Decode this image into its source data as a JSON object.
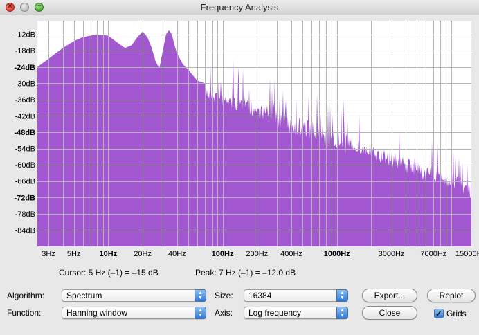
{
  "window": {
    "title": "Frequency Analysis"
  },
  "chart_data": {
    "type": "area",
    "xscale": "log",
    "xlim": [
      2.4,
      15000
    ],
    "ylim": [
      -90,
      -7
    ],
    "y_ticks": [
      {
        "v": -12,
        "label": "-12dB",
        "bold": false
      },
      {
        "v": -18,
        "label": "-18dB",
        "bold": false
      },
      {
        "v": -24,
        "label": "-24dB",
        "bold": true
      },
      {
        "v": -30,
        "label": "-30dB",
        "bold": false
      },
      {
        "v": -36,
        "label": "-36dB",
        "bold": false
      },
      {
        "v": -42,
        "label": "-42dB",
        "bold": false
      },
      {
        "v": -48,
        "label": "-48dB",
        "bold": true
      },
      {
        "v": -54,
        "label": "-54dB",
        "bold": false
      },
      {
        "v": -60,
        "label": "-60dB",
        "bold": false
      },
      {
        "v": -66,
        "label": "-66dB",
        "bold": false
      },
      {
        "v": -72,
        "label": "-72dB",
        "bold": true
      },
      {
        "v": -78,
        "label": "-78dB",
        "bold": false
      },
      {
        "v": -84,
        "label": "-84dB",
        "bold": false
      }
    ],
    "x_ticks": [
      {
        "v": 3,
        "label": "3Hz",
        "bold": false
      },
      {
        "v": 5,
        "label": "5Hz",
        "bold": false
      },
      {
        "v": 10,
        "label": "10Hz",
        "bold": true
      },
      {
        "v": 20,
        "label": "20Hz",
        "bold": false
      },
      {
        "v": 40,
        "label": "40Hz",
        "bold": false
      },
      {
        "v": 100,
        "label": "100Hz",
        "bold": true
      },
      {
        "v": 200,
        "label": "200Hz",
        "bold": false
      },
      {
        "v": 400,
        "label": "400Hz",
        "bold": false
      },
      {
        "v": 1000,
        "label": "1000Hz",
        "bold": true
      },
      {
        "v": 3000,
        "label": "3000Hz",
        "bold": false
      },
      {
        "v": 7000,
        "label": "7000Hz",
        "bold": false
      },
      {
        "v": 15000,
        "label": "15000Hz",
        "bold": false
      }
    ],
    "grid": true,
    "fill_color": "#a358d2",
    "series": [
      {
        "x": [
          2.4,
          3,
          4,
          5,
          6,
          7,
          8,
          10,
          12,
          14,
          16,
          18,
          20,
          22,
          24,
          26,
          28,
          30,
          32,
          34,
          36,
          38,
          40,
          45,
          50,
          60,
          70,
          80,
          90,
          100,
          120,
          150,
          200,
          250,
          300,
          400,
          500,
          600,
          800,
          1000,
          1500,
          2000,
          3000,
          4000,
          5000,
          7000,
          10000,
          13000,
          15000
        ],
        "y": [
          -24,
          -21,
          -17,
          -14.5,
          -13,
          -12.5,
          -12,
          -12.5,
          -15,
          -17,
          -16,
          -13,
          -11,
          -13,
          -17,
          -22,
          -24.5,
          -18,
          -12,
          -10.5,
          -12,
          -16,
          -19,
          -23,
          -25,
          -29,
          -30,
          -31,
          -32,
          -33,
          -34,
          -35,
          -37,
          -38,
          -39,
          -40,
          -42,
          -43,
          -45,
          -47,
          -50,
          -53,
          -55,
          -57,
          -59,
          -61,
          -63,
          -65,
          -68
        ]
      }
    ]
  },
  "readout": {
    "cursor": "Cursor: 5 Hz (–1) = –15 dB",
    "peak": "Peak: 7 Hz (–1) = –12.0 dB"
  },
  "controls": {
    "algorithm_label": "Algorithm:",
    "algorithm_value": "Spectrum",
    "function_label": "Function:",
    "function_value": "Hanning window",
    "size_label": "Size:",
    "size_value": "16384",
    "axis_label": "Axis:",
    "axis_value": "Log frequency",
    "export_label": "Export...",
    "replot_label": "Replot",
    "close_label": "Close",
    "grids_label": "Grids",
    "grids_checked": true,
    "checkmark": "✓"
  }
}
